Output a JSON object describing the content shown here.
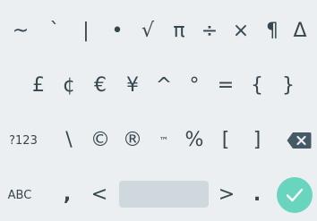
{
  "keyboard": {
    "row1": [
      "~",
      "`",
      "|",
      "•",
      "√",
      "π",
      "÷",
      "×",
      "¶",
      "Δ"
    ],
    "row2": [
      "£",
      "¢",
      "€",
      "¥",
      "^",
      "°",
      "=",
      "{",
      "}"
    ],
    "row3": {
      "mode": "?123",
      "keys": [
        "\\",
        "©",
        "®",
        "™",
        "%",
        "[",
        "]"
      ]
    },
    "row4": {
      "mode": "ABC",
      "keys": [
        ",",
        "<",
        ">",
        "."
      ]
    }
  },
  "colors": {
    "background": "#eceff1",
    "key_text": "#37474f",
    "enter": "#6ad5be",
    "space": "#cfd8dc"
  },
  "icons": {
    "backspace": "backspace-icon",
    "enter": "check-icon"
  }
}
